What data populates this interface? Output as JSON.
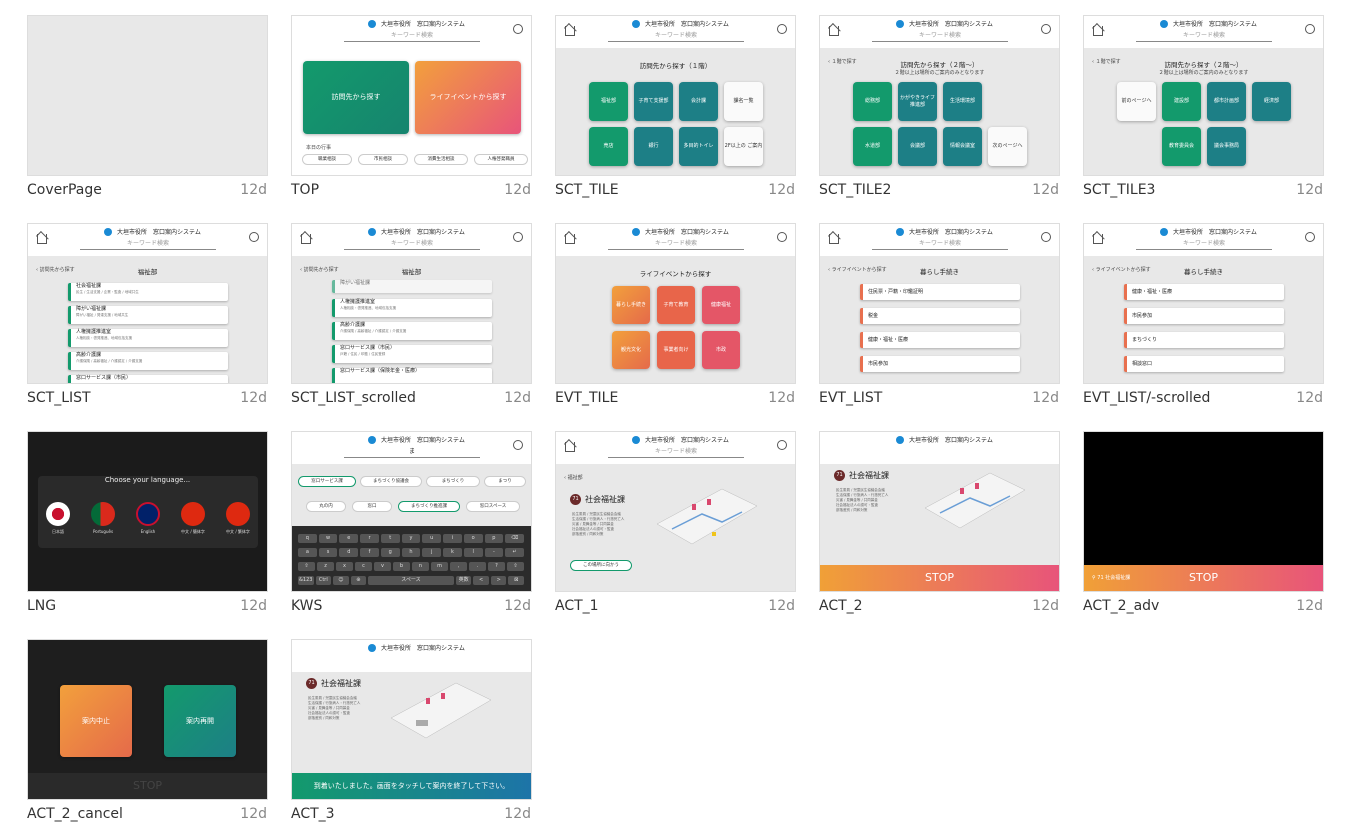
{
  "common": {
    "app_title": "大垣市役所　窓口案内システム",
    "search_placeholder": "キーワード検索",
    "home_icon": "home-icon",
    "language_icon": "globe-icon",
    "accent_green": "#139a6c",
    "accent_teal": "#1d7f86",
    "accent_orange": "#f2a03c",
    "accent_pink": "#e8547a"
  },
  "cards": [
    {
      "name": "CoverPage",
      "age": "12d"
    },
    {
      "name": "TOP",
      "age": "12d"
    },
    {
      "name": "SCT_TILE",
      "age": "12d"
    },
    {
      "name": "SCT_TILE2",
      "age": "12d"
    },
    {
      "name": "SCT_TILE3",
      "age": "12d"
    },
    {
      "name": "SCT_LIST",
      "age": "12d"
    },
    {
      "name": "SCT_LIST_scrolled",
      "age": "12d"
    },
    {
      "name": "EVT_TILE",
      "age": "12d"
    },
    {
      "name": "EVT_LIST",
      "age": "12d"
    },
    {
      "name": "EVT_LIST/-scrolled",
      "age": "12d"
    },
    {
      "name": "LNG",
      "age": "12d"
    },
    {
      "name": "KWS",
      "age": "12d"
    },
    {
      "name": "ACT_1",
      "age": "12d"
    },
    {
      "name": "ACT_2",
      "age": "12d"
    },
    {
      "name": "ACT_2_adv",
      "age": "12d"
    },
    {
      "name": "ACT_2_cancel",
      "age": "12d"
    },
    {
      "name": "ACT_3",
      "age": "12d"
    }
  ],
  "top": {
    "btn_visit": "訪問先から探す",
    "btn_life": "ライフイベントから探す",
    "today": "本日の行事",
    "events": [
      "職業相談",
      "市民相談",
      "消費生活相談",
      "人権啓発職員"
    ]
  },
  "sct_tile": {
    "title": "訪問先から探す（１階）",
    "tiles": [
      "福祉部",
      "子育て支援部",
      "会計課",
      "課名一覧",
      "売店",
      "銀行",
      "多目的トイレ",
      "2F以上の ご案内"
    ]
  },
  "sct_tile2": {
    "back": "１階で探す",
    "title": "訪問先から探す（２階～）",
    "sub": "２階以上は場所のご案内のみとなります",
    "tiles": [
      "総務部",
      "かがやきライフ推進部",
      "生活環境部",
      "水道部",
      "会議部",
      "情報会議室",
      "次のページへ"
    ]
  },
  "sct_tile3": {
    "back": "１階で探す",
    "title": "訪問先から探す（２階～）",
    "sub": "２階以上は場所のご案内のみとなります",
    "tiles": [
      "前のページへ",
      "建設部",
      "都市計画部",
      "経済部",
      "教育委員会",
      "議会事務局"
    ]
  },
  "sct_list": {
    "back": "訪問先から探す",
    "title": "福祉部",
    "rows": [
      {
        "t": "社会福祉課",
        "s": "民生 / 生活支援 / 企業・監査 / 地域共生"
      },
      {
        "t": "障がい福祉課",
        "s": "障がい福祉 / 発達支援 / 地域共生"
      },
      {
        "t": "人権擁護推進室",
        "s": "人権相談・啓発推進、地域包括支援"
      },
      {
        "t": "高齢介護課",
        "s": "介護保険 / 高齢福祉 / 介護認定 / 介護支援"
      },
      {
        "t": "窓口サービス課（市民）",
        "s": ""
      }
    ]
  },
  "sct_list_scrolled": {
    "back": "訪問先から探す",
    "title": "福祉部",
    "rows": [
      {
        "t": "障がい福祉課",
        "s": "障がい福祉 / 発達支援 / 地域共生"
      },
      {
        "t": "人権擁護推進室",
        "s": "人権相談・啓発推進、地域包括支援"
      },
      {
        "t": "高齢介護課",
        "s": "介護保険 / 高齢福祉 / 介護認定 / 介護支援"
      },
      {
        "t": "窓口サービス課（市民）",
        "s": "戸籍 / 住民 / 印鑑 / 住民登録"
      },
      {
        "t": "窓口サービス課（保険年金・医療）",
        "s": ""
      }
    ]
  },
  "evt_tile": {
    "title": "ライフイベントから探す",
    "tiles": [
      "暮らし手続き",
      "子育て教育",
      "健康福祉",
      "観光文化",
      "事業者向け",
      "市政"
    ]
  },
  "evt_list": {
    "back": "ライフイベントから探す",
    "title": "暮らし手続き",
    "rows": [
      "住民票・戸籍・印鑑証明",
      "税金",
      "健康・福祉・医療",
      "市民参加"
    ]
  },
  "evt_list_scrolled": {
    "back": "ライフイベントから探す",
    "title": "暮らし手続き",
    "rows": [
      "健康・福祉・医療",
      "市民参加",
      "まちづくり",
      "相談窓口"
    ]
  },
  "lng": {
    "title": "Choose your language...",
    "langs": [
      "日本語",
      "Português",
      "English",
      "中文 / 簡体字",
      "中文 / 繁体字"
    ]
  },
  "kws": {
    "query": "ま",
    "chips": [
      "窓口サービス課",
      "まちづくり協議会",
      "まちづくり",
      "まつり",
      "丸の内",
      "窓口",
      "まちづくり推進課",
      "窓口スペース"
    ],
    "keys": [
      [
        "q",
        "w",
        "e",
        "r",
        "t",
        "y",
        "u",
        "i",
        "o",
        "p",
        "⌫"
      ],
      [
        "a",
        "s",
        "d",
        "f",
        "g",
        "h",
        "j",
        "k",
        "l",
        "-",
        "↵"
      ],
      [
        "⇧",
        "z",
        "x",
        "c",
        "v",
        "b",
        "n",
        "m",
        ",",
        ".",
        "?",
        "⇧"
      ],
      [
        "&123",
        "Ctrl",
        "☺",
        "⊕",
        "スペース",
        "英数",
        "<",
        ">",
        "⊠"
      ]
    ]
  },
  "act": {
    "back": "福祉部",
    "number": "71",
    "dept": "社会福祉課",
    "desc": [
      "民生委員 / 児童民生協議会会議",
      "生活保護 / 行旅病人・行旅死亡人",
      "災害 / 見舞金等 / 共同募金",
      "社会福祉法人の認可・監査",
      "部落差別 / 同和対策"
    ],
    "goto_btn": "この場所に向かう",
    "stop": "STOP",
    "adv_dest": "71 社会福祉課",
    "cancel": "案内中止",
    "resume": "案内再開",
    "arrived": "到着いたしました。画面をタッチして案内を終了して下さい。"
  }
}
